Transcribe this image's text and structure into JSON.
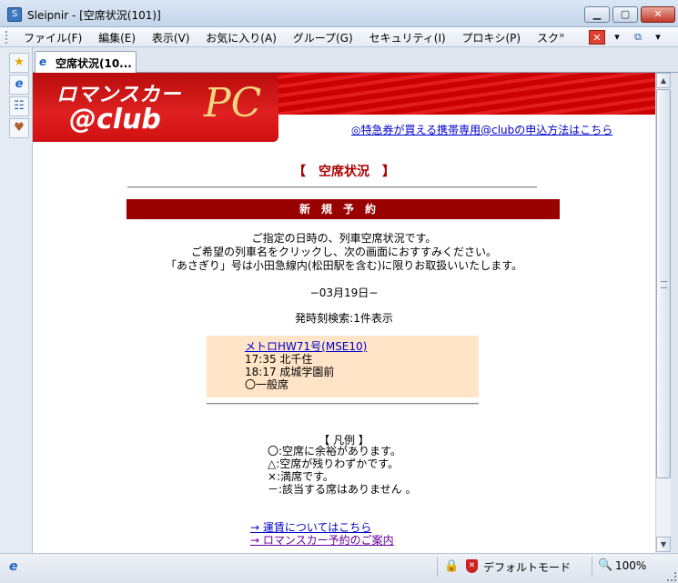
{
  "window": {
    "app_icon": "sleipnir-icon",
    "title": "Sleipnir - [空席状況(101)]",
    "minimize": "▁",
    "maximize": "▢",
    "close": "✕"
  },
  "menu": {
    "items": [
      "ファイル(F)",
      "編集(E)",
      "表示(V)",
      "お気に入り(A)",
      "グループ(G)",
      "セキュリティ(I)",
      "プロキシ(P)",
      "スク"
    ],
    "overflow": "»"
  },
  "tab": {
    "label": "空席状況(10..."
  },
  "banner": {
    "logo_top": "ロマンスカー",
    "logo_bottom": "@club",
    "logo_pc": "PC",
    "link": "◎特急券が買える携帯専用@clubの申込方法はこちら"
  },
  "page": {
    "heading": "【　空席状況　】",
    "section": "新規予約",
    "intro": [
      "ご指定の日時の、列車空席状況です。",
      "ご希望の列車名をクリックし、次の画面におすすみください。",
      "「あさぎり」号は小田急線内(松田駅を含む)に限りお取扱いいたします。"
    ],
    "date": "−03月19日−",
    "result_count": "発時刻検索:1件表示",
    "train": {
      "name": "メトロHW71号(MSE10)",
      "departure": "17:35 北千住",
      "arrival": "18:17 成城学園前",
      "seat": "〇一般席"
    },
    "legend_title": "【 凡例 】",
    "legend": [
      "〇:空席に余裕があります。",
      "△:空席が残りわずかです。",
      "×:満席です。",
      "－:該当する席はありません 。"
    ],
    "links": [
      "→ 運賃についてはこちら",
      "→ ロマンスカー予約のご案内"
    ]
  },
  "statusbar": {
    "mode": "デフォルトモード",
    "zoom": "100%"
  },
  "colors": {
    "banner_red": "#cc0000",
    "section_bar": "#990000",
    "heading": "#aa0000",
    "train_box": "#ffe4c8",
    "link": "#0000cc"
  }
}
